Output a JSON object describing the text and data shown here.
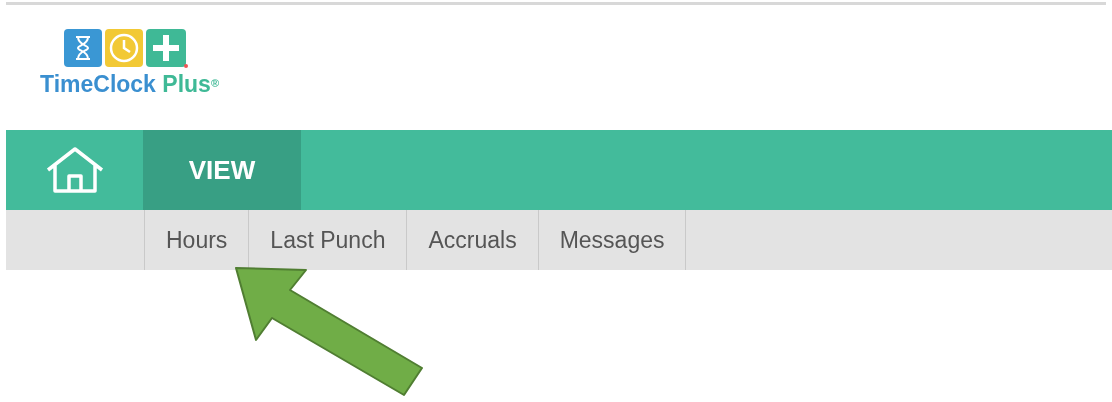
{
  "logo": {
    "name": "TimeClock",
    "suffix": "Plus",
    "mark": "®"
  },
  "nav": {
    "tabs": [
      {
        "label": "VIEW",
        "selected": true
      }
    ]
  },
  "subnav": {
    "tabs": [
      {
        "label": "Hours",
        "selected": false
      },
      {
        "label": "Last Punch",
        "selected": false
      },
      {
        "label": "Accruals",
        "selected": false
      },
      {
        "label": "Messages",
        "selected": false
      }
    ]
  }
}
